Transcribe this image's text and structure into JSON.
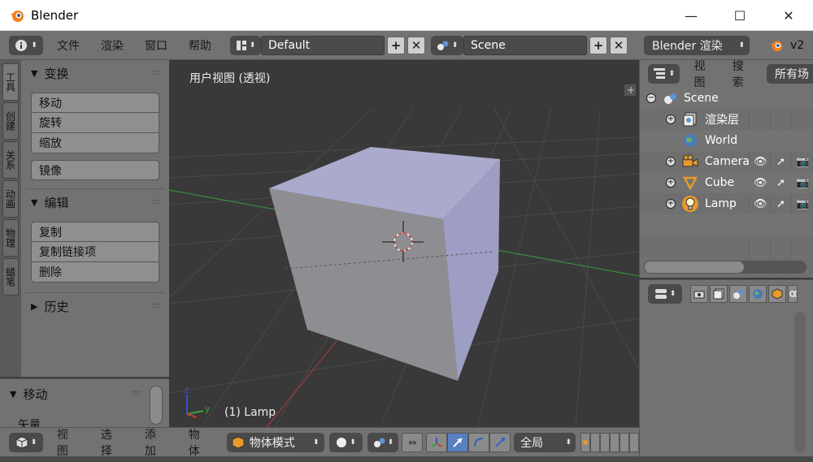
{
  "window": {
    "title": "Blender",
    "minimize": "—",
    "maximize": "☐",
    "close": "✕"
  },
  "infobar": {
    "menus": [
      "文件",
      "渲染",
      "窗口",
      "帮助"
    ],
    "layout": "Default",
    "scene": "Scene",
    "engine": "Blender 渲染",
    "version": "v2"
  },
  "tabs": [
    "工具",
    "创建",
    "关系",
    "动画",
    "物理",
    "蜡笔"
  ],
  "toolshelf": {
    "transform_header": "变换",
    "move": "移动",
    "rotate": "旋转",
    "scale": "缩放",
    "mirror": "镜像",
    "edit_header": "编辑",
    "duplicate": "复制",
    "duplicate_linked": "复制链接项",
    "delete": "删除",
    "history_header": "历史"
  },
  "operator": {
    "header": "移动",
    "vector": "矢量"
  },
  "viewport": {
    "label": "用户视图 (透视)",
    "object": "(1) Lamp",
    "axis_z": "z",
    "axis_y": "y"
  },
  "bottombar": {
    "menus": [
      "视图",
      "选择",
      "添加",
      "物体"
    ],
    "mode": "物体模式",
    "pivot": "全局"
  },
  "outliner": {
    "view": "视图",
    "search": "搜索",
    "filter": "所有场",
    "items": [
      {
        "name": "Scene",
        "expander": "−"
      },
      {
        "name": "渲染层",
        "expander": "+"
      },
      {
        "name": "World",
        "expander": ""
      },
      {
        "name": "Camera",
        "expander": "+"
      },
      {
        "name": "Cube",
        "expander": "+"
      },
      {
        "name": "Lamp",
        "expander": "+"
      }
    ]
  },
  "colors": {
    "panel": "#727272",
    "viewport": "#393939",
    "cube_top": "#aaaacc",
    "cube_front": "#8e8e92",
    "cube_side": "#9e9ec4",
    "x_axis": "#b53a3a",
    "y_axis": "#3a9a3a",
    "select_blue": "#5680c2"
  }
}
